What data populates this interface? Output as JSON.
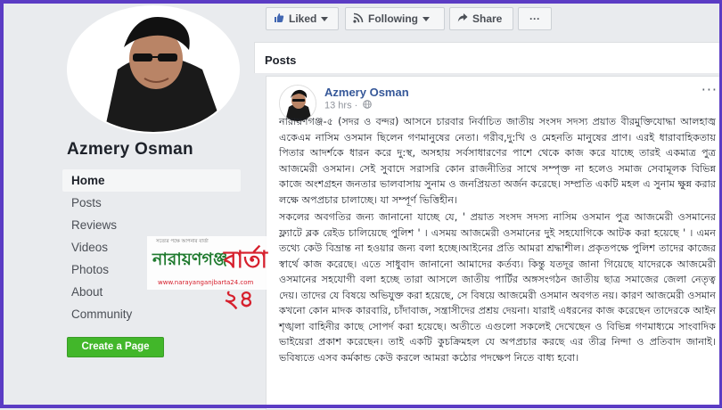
{
  "page": {
    "name": "Azmery Osman",
    "nav": [
      {
        "label": "Home",
        "active": true
      },
      {
        "label": "Posts"
      },
      {
        "label": "Reviews"
      },
      {
        "label": "Videos"
      },
      {
        "label": "Photos"
      },
      {
        "label": "About"
      },
      {
        "label": "Community"
      }
    ],
    "create_button": "Create a Page"
  },
  "actions": {
    "liked": "Liked",
    "following": "Following",
    "share": "Share",
    "more": "···"
  },
  "posts_section": {
    "title": "Posts"
  },
  "post": {
    "author": "Azmery Osman",
    "time": "13 hrs ·",
    "more": "···",
    "paragraphs": [
      "নারায়ণগঞ্জ-৫ (সদর ও বন্দর) আসনে চারবার নির্বাচিত জাতীয় সংসদ সদস্য প্রয়াত বীরমুক্তিযোদ্ধা আলহাজ্ব একেএম নাসিম ওসমান ছিলেন গণমানুষের নেতা। গরীব,দু:খি ও মেহনতি মানুষের প্রাণ। এরই ধারাবাহিকতায় পিতার আদর্শকে ধারন করে দু:স্থ, অসহায় সর্বসাধারণের পাশে থেকে কাজ করে যাচ্ছে তারই একমাত্র পুত্র আজমেরী ওসমান। সেই সুবাদে সরাসরি কোন রাজনীতির সাথে সম্পৃক্ত না হলেও সমাজ সেবামূলক বিভিন্ন কাজে অংশগ্রহন জনতার ভালবাসায় সুনাম ও জনপ্রিয়তা অর্জন করেছে। সম্প্রতি একটি মহল এ সুনাম ক্ষুন্ন করার লক্ষে অপপ্রচার চালাচ্ছে। যা সম্পূর্ণ ভিত্তিহীন।",
      "সকলের অবগতির জন্য জানানো যাচ্ছে যে, ' প্রয়াত সংসদ সদস্য নাসিম ওসমান পুত্র আজমেরী ওসমানের ফ্ল্যাটে ব্লক রেইড চালিয়েছে পুলিশ ' । এসময় আজমেরী ওসমানের দুই সহযোগিকে আটক করা হয়েছে ' । এমন তথ্যে কেউ বিভ্রান্ত না হওয়ার জন্য বলা হচ্ছে।আইনের প্রতি আমরা শ্রদ্ধাশীল। প্রকৃতপক্ষে পুলিশ তাদের কাজের স্বার্থে কাজ করেছে। এতে সাধুবাদ জানানো আমাদের কর্তব্য। কিন্তু যতদূর জানা গিয়েছে যাদেরকে আজমেরী ওসমানের সহযোগী বলা হচ্ছে তারা আসলে জাতীয় পার্টির অঙ্গসংগঠন জাতীয় ছাত্র সমাজের জেলা নেতৃত্ব দেয়। তাদের যে বিষয়ে অভিযুক্ত করা হয়েছে, সে বিষয়ে আজমেরী ওসমান অবগত নয়। কারণ আজমেরী ওসমান কখনো কোন মাদক কারবারি, চাঁদাবাজ, সন্ত্রাসীদের প্রশ্রয় দেয়না। যারাই এধরনের কাজ করেছেন তাদেরকে আইন শৃঙ্খলা বাহিনীর কাছে সোপর্দ করা হয়েছে। অতীতে এগুলো সকলেই দেখেছেন ও বিভিন্ন গণমাধ্যমে সাংবাদিক ভাইয়েরা প্রকাশ করেছেন। তাই একটি কুচক্রিমহল যে অপপ্রচার করছে এর তীব্র নিন্দা ও প্রতিবাদ জানাই। ভবিষ্যতে এসব কর্মকান্ড কেউ করলে আমরা কঠোর পদক্ষেপ নিতে বাধ্য হবো।"
    ]
  },
  "watermark": {
    "tagline": "সত্যের পক্ষে আপনার বার্তা",
    "left": "নারায়ণগঞ্জ",
    "right": "বার্তা ২৪",
    "url": "www.narayanganjbarta24.com"
  },
  "colors": {
    "link": "#365899",
    "accent_green": "#42b72a",
    "frame": "#5b3cc4",
    "watermark_green": "#1f7a2e",
    "watermark_red": "#d6202d"
  },
  "icons": [
    "thumbs-up-icon",
    "rss-icon",
    "share-arrow-icon",
    "globe-icon",
    "caret-down-icon"
  ]
}
